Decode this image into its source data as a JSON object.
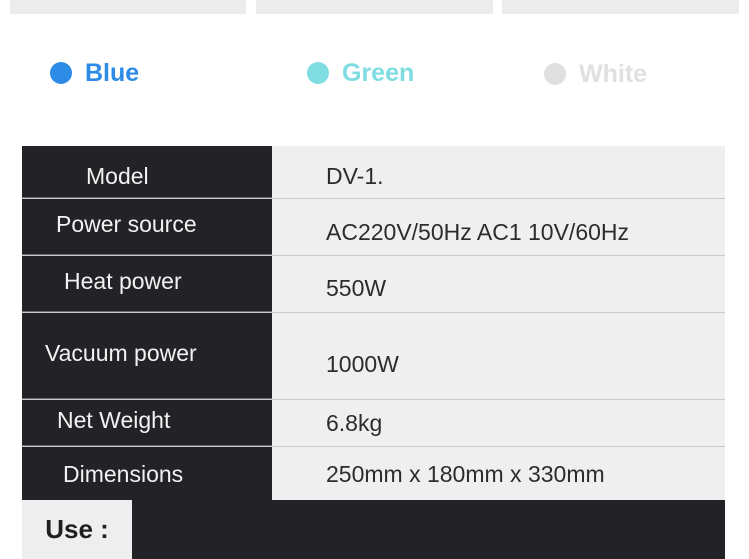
{
  "colors": {
    "options": [
      {
        "label": "Blue",
        "dot": "#2e8be6",
        "text": "#2e8be6"
      },
      {
        "label": "Green",
        "dot": "#7fdde2",
        "text": "#7fdde2"
      },
      {
        "label": "White",
        "dot": "#e0e0e0",
        "text": "#e0e0e0"
      }
    ]
  },
  "specs": {
    "rows": [
      {
        "label": "Model",
        "value": "DV-1."
      },
      {
        "label": "Power source",
        "value": "AC220V/50Hz AC1 10V/60Hz"
      },
      {
        "label": "Heat power",
        "value": "550W"
      },
      {
        "label": "Vacuum power",
        "value": "1000W"
      },
      {
        "label": "Net Weight",
        "value": "6.8kg"
      },
      {
        "label": "Dimensions",
        "value": "250mm x 180mm x 330mm"
      }
    ]
  },
  "use": {
    "label": "Use :"
  }
}
